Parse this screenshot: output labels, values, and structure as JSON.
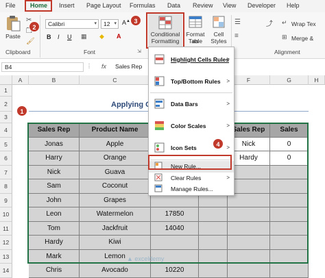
{
  "tabs": [
    "File",
    "Home",
    "Insert",
    "Page Layout",
    "Formulas",
    "Data",
    "Review",
    "View",
    "Developer",
    "Help"
  ],
  "ribbon": {
    "paste": "Paste",
    "clipboard": "Clipboard",
    "font_name": "Calibri",
    "font_size": "12",
    "font_group": "Font",
    "bold": "B",
    "italic": "I",
    "underline": "U",
    "cond_fmt_line1": "Conditional",
    "cond_fmt_line2": "Formatting",
    "format_table_line1": "Format as",
    "format_table_line2": "Table",
    "cell_styles_line1": "Cell",
    "cell_styles_line2": "Styles",
    "wrap_text": "Wrap Tex",
    "merge": "Merge &",
    "alignment": "Alignment"
  },
  "badges": [
    "1",
    "2",
    "3",
    "4"
  ],
  "formula_bar": {
    "name_box": "B4",
    "fx": "fx",
    "value": "Sales Rep"
  },
  "columns": [
    "A",
    "B",
    "C",
    "D",
    "E",
    "F",
    "G",
    "H"
  ],
  "rows": [
    "1",
    "2",
    "3",
    "4",
    "5",
    "6",
    "7",
    "8",
    "9",
    "10",
    "11",
    "12",
    "13",
    "14"
  ],
  "sheet_title": "Applying C",
  "table": {
    "headers": [
      "Sales Rep",
      "Product Name"
    ],
    "rows": [
      [
        "Jonas",
        "Apple"
      ],
      [
        "Harry",
        "Orange"
      ],
      [
        "Nick",
        "Guava"
      ],
      [
        "Sam",
        "Coconut"
      ],
      [
        "John",
        "Grapes"
      ],
      [
        "Leon",
        "Watermelon"
      ],
      [
        "Tom",
        "Jackfruit"
      ],
      [
        "Hardy",
        "Kiwi"
      ],
      [
        "Mark",
        "Lemon"
      ],
      [
        "Chris",
        "Avocado"
      ]
    ],
    "sales_visible": [
      "",
      "",
      "",
      "",
      "",
      "17850",
      "14040",
      "",
      "",
      "10220"
    ]
  },
  "lookup": {
    "headers": [
      "Sales Rep",
      "Sales"
    ],
    "rows": [
      [
        "Nick",
        "0"
      ],
      [
        "Hardy",
        "0"
      ]
    ]
  },
  "menu": {
    "items": [
      {
        "label": "Highlight Cells Rules",
        "arrow": ">"
      },
      {
        "label": "Top/Bottom Rules",
        "arrow": ">"
      },
      {
        "label": "Data Bars",
        "arrow": ">"
      },
      {
        "label": "Color Scales",
        "arrow": ">"
      },
      {
        "label": "Icon Sets",
        "arrow": ">"
      }
    ],
    "new_rule": "New Rule...",
    "clear_rules": "Clear Rules",
    "clear_arrow": ">",
    "manage_rules": "Manage Rules..."
  },
  "watermark": "exceldemy",
  "colors": {
    "accent_red": "#c0392b",
    "excel_green": "#217346",
    "title_blue": "#2e4a78"
  }
}
